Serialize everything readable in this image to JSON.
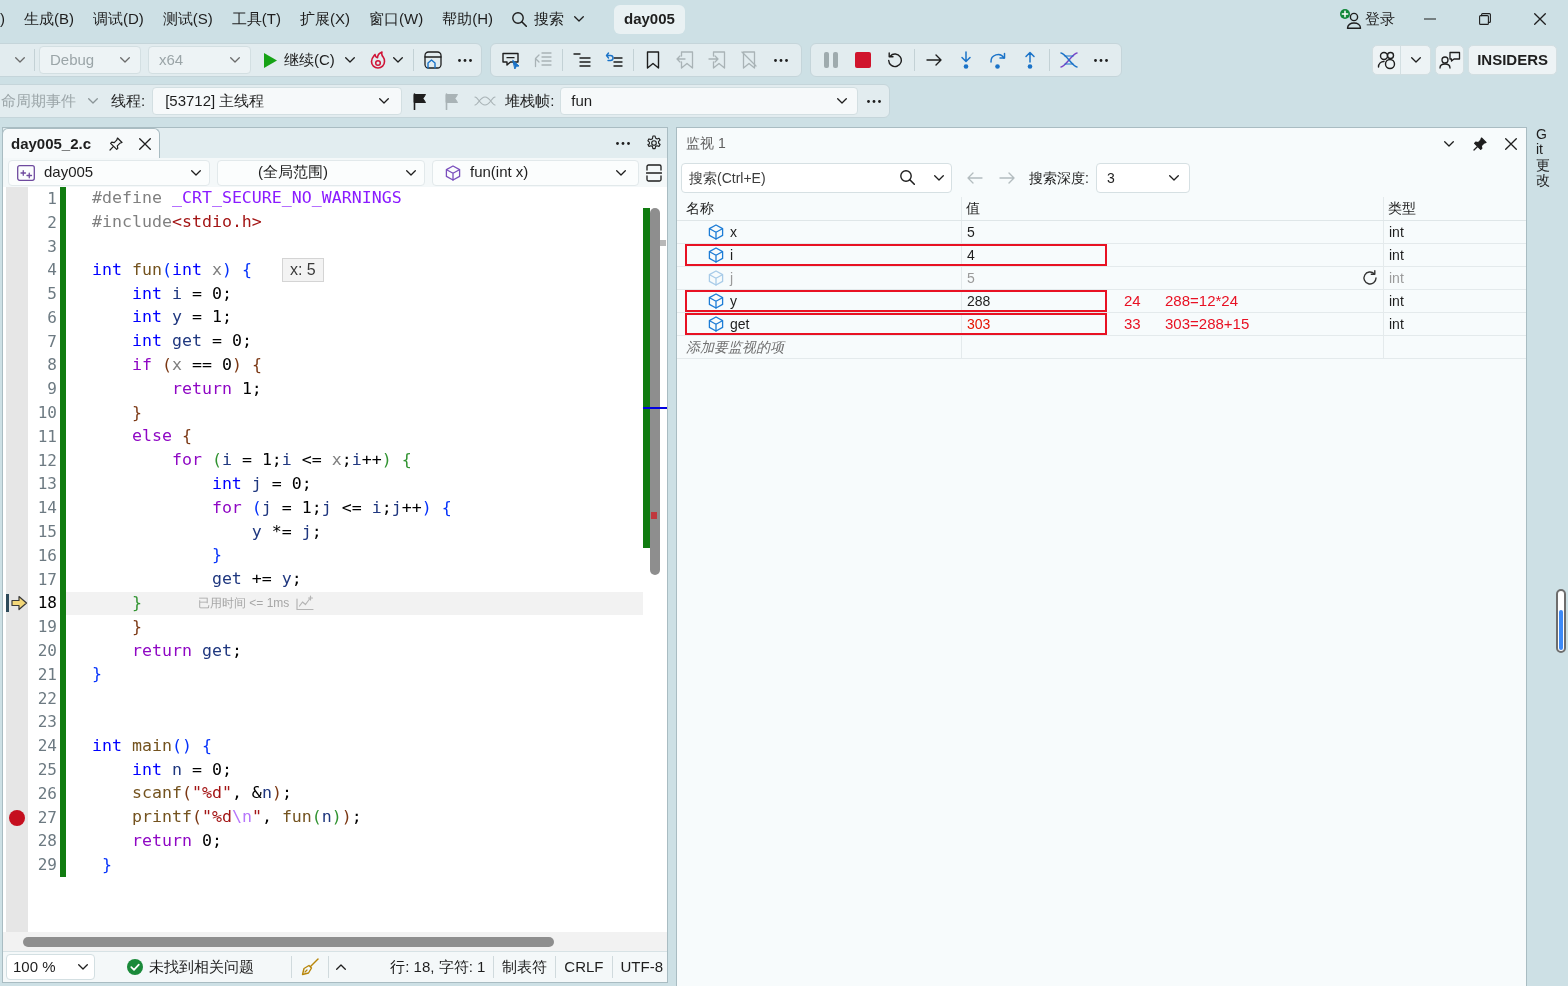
{
  "menu_bar": {
    "items": [
      ")",
      "生成(B)",
      "调试(D)",
      "测试(S)",
      "工具(T)",
      "扩展(X)",
      "窗口(W)",
      "帮助(H)"
    ],
    "search": "搜索",
    "solution": "day005",
    "sign_in": "登录"
  },
  "debug_toolbar": {
    "configuration": {
      "value": "Debug",
      "disabled": true
    },
    "platform": {
      "value": "x64",
      "disabled": true
    },
    "continue": "继续(C)",
    "badge": "INSIDERS"
  },
  "location_toolbar": {
    "lifecycle_events": {
      "value": "命周期事件",
      "disabled": true
    },
    "thread_label": "线程:",
    "thread": "[53712] 主线程",
    "stack_frame_label": "堆栈帧:",
    "stack_frame": "fun"
  },
  "editor": {
    "tab": {
      "title": "day005_2.c",
      "selected": true
    },
    "project": "day005",
    "scope": "(全局范围)",
    "member": "fun(int x)",
    "lines": [
      {
        "number": "1",
        "current": false,
        "breakpoint": false,
        "tokens": [
          {
            "kind": "pp",
            "text": "#define "
          },
          {
            "kind": "mac",
            "text": "_CRT_SECURE_NO_WARNINGS"
          }
        ]
      },
      {
        "number": "2",
        "current": false,
        "breakpoint": false,
        "tokens": [
          {
            "kind": "pp",
            "text": "#include"
          },
          {
            "kind": "inc",
            "text": "<stdio.h>"
          }
        ]
      },
      {
        "number": "3",
        "current": false,
        "breakpoint": false
      },
      {
        "number": "4",
        "current": false,
        "breakpoint": false,
        "tokens": [
          {
            "kind": "kw",
            "text": "int "
          },
          {
            "kind": "fn",
            "text": "fun"
          },
          {
            "kind": "b1",
            "text": "("
          },
          {
            "kind": "kw",
            "text": "int "
          },
          {
            "kind": "par",
            "text": "x"
          },
          {
            "kind": "b1",
            "text": ")"
          },
          {
            "kind": "b1",
            "text": " {"
          }
        ],
        "hint": "x: 5"
      },
      {
        "number": "5",
        "current": false,
        "breakpoint": false,
        "tokens": [
          {
            "kind": "kw",
            "text": "    int "
          },
          {
            "kind": "id",
            "text": "i"
          },
          {
            "kind": "op",
            "text": " = 0;"
          }
        ]
      },
      {
        "number": "6",
        "current": false,
        "breakpoint": false,
        "tokens": [
          {
            "kind": "kw",
            "text": "    int "
          },
          {
            "kind": "id",
            "text": "y"
          },
          {
            "kind": "op",
            "text": " = 1;"
          }
        ]
      },
      {
        "number": "7",
        "current": false,
        "breakpoint": false,
        "tokens": [
          {
            "kind": "kw",
            "text": "    int "
          },
          {
            "kind": "id",
            "text": "get"
          },
          {
            "kind": "op",
            "text": " = 0;"
          }
        ]
      },
      {
        "number": "8",
        "current": false,
        "breakpoint": false,
        "tokens": [
          {
            "kind": "ctl",
            "text": "    if "
          },
          {
            "kind": "b2",
            "text": "("
          },
          {
            "kind": "par",
            "text": "x"
          },
          {
            "kind": "op",
            "text": " == 0"
          },
          {
            "kind": "b2",
            "text": ")"
          },
          {
            "kind": "b2",
            "text": " {"
          }
        ]
      },
      {
        "number": "9",
        "current": false,
        "breakpoint": false,
        "tokens": [
          {
            "kind": "ctl",
            "text": "        return "
          },
          {
            "kind": "op",
            "text": "1;"
          }
        ]
      },
      {
        "number": "10",
        "current": false,
        "breakpoint": false,
        "tokens": [
          {
            "kind": "b2",
            "text": "    }"
          }
        ]
      },
      {
        "number": "11",
        "current": false,
        "breakpoint": false,
        "tokens": [
          {
            "kind": "ctl",
            "text": "    else "
          },
          {
            "kind": "b2",
            "text": "{"
          }
        ]
      },
      {
        "number": "12",
        "current": false,
        "breakpoint": false,
        "tokens": [
          {
            "kind": "ctl",
            "text": "        for "
          },
          {
            "kind": "b3",
            "text": "("
          },
          {
            "kind": "id",
            "text": "i"
          },
          {
            "kind": "op",
            "text": " = 1;"
          },
          {
            "kind": "id",
            "text": "i"
          },
          {
            "kind": "op",
            "text": " <= "
          },
          {
            "kind": "par",
            "text": "x"
          },
          {
            "kind": "op",
            "text": ";"
          },
          {
            "kind": "id",
            "text": "i"
          },
          {
            "kind": "op",
            "text": "++"
          },
          {
            "kind": "b3",
            "text": ")"
          },
          {
            "kind": "b3",
            "text": " {"
          }
        ]
      },
      {
        "number": "13",
        "current": false,
        "breakpoint": false,
        "tokens": [
          {
            "kind": "kw",
            "text": "            int "
          },
          {
            "kind": "id",
            "text": "j"
          },
          {
            "kind": "op",
            "text": " = 0;"
          }
        ]
      },
      {
        "number": "14",
        "current": false,
        "breakpoint": false,
        "tokens": [
          {
            "kind": "ctl",
            "text": "            for "
          },
          {
            "kind": "b1",
            "text": "("
          },
          {
            "kind": "id",
            "text": "j"
          },
          {
            "kind": "op",
            "text": " = 1;"
          },
          {
            "kind": "id",
            "text": "j"
          },
          {
            "kind": "op",
            "text": " <= "
          },
          {
            "kind": "id",
            "text": "i"
          },
          {
            "kind": "op",
            "text": ";"
          },
          {
            "kind": "id",
            "text": "j"
          },
          {
            "kind": "op",
            "text": "++"
          },
          {
            "kind": "b1",
            "text": ")"
          },
          {
            "kind": "b1",
            "text": " {"
          }
        ]
      },
      {
        "number": "15",
        "current": false,
        "breakpoint": false,
        "tokens": [
          {
            "kind": "id",
            "text": "                y"
          },
          {
            "kind": "op",
            "text": " *= "
          },
          {
            "kind": "id",
            "text": "j"
          },
          {
            "kind": "op",
            "text": ";"
          }
        ]
      },
      {
        "number": "16",
        "current": false,
        "breakpoint": false,
        "tokens": [
          {
            "kind": "b1",
            "text": "            }"
          }
        ]
      },
      {
        "number": "17",
        "current": false,
        "breakpoint": false,
        "tokens": [
          {
            "kind": "id",
            "text": "            get"
          },
          {
            "kind": "op",
            "text": " += "
          },
          {
            "kind": "id",
            "text": "y"
          },
          {
            "kind": "op",
            "text": ";"
          }
        ]
      },
      {
        "number": "18",
        "current": true,
        "breakpoint": false,
        "tokens": [
          {
            "kind": "b3",
            "text": "    }"
          }
        ],
        "perf_tip": "已用时间 <= 1ms"
      },
      {
        "number": "19",
        "current": false,
        "breakpoint": false,
        "tokens": [
          {
            "kind": "b2",
            "text": "    }"
          }
        ]
      },
      {
        "number": "20",
        "current": false,
        "breakpoint": false,
        "tokens": [
          {
            "kind": "ctl",
            "text": "    return "
          },
          {
            "kind": "id",
            "text": "get"
          },
          {
            "kind": "op",
            "text": ";"
          }
        ]
      },
      {
        "number": "21",
        "current": false,
        "breakpoint": false,
        "tokens": [
          {
            "kind": "b1",
            "text": "}"
          }
        ]
      },
      {
        "number": "22",
        "current": false,
        "breakpoint": false
      },
      {
        "number": "23",
        "current": false,
        "breakpoint": false
      },
      {
        "number": "24",
        "current": false,
        "breakpoint": false,
        "tokens": [
          {
            "kind": "kw",
            "text": "int "
          },
          {
            "kind": "fn",
            "text": "main"
          },
          {
            "kind": "b1",
            "text": "()"
          },
          {
            "kind": "b1",
            "text": " {"
          }
        ]
      },
      {
        "number": "25",
        "current": false,
        "breakpoint": false,
        "tokens": [
          {
            "kind": "kw",
            "text": "    int "
          },
          {
            "kind": "id",
            "text": "n"
          },
          {
            "kind": "op",
            "text": " = 0;"
          }
        ]
      },
      {
        "number": "26",
        "current": false,
        "breakpoint": false,
        "tokens": [
          {
            "kind": "fn",
            "text": "    scanf"
          },
          {
            "kind": "b2",
            "text": "("
          },
          {
            "kind": "str",
            "text": "\"%d\""
          },
          {
            "kind": "op",
            "text": ", &"
          },
          {
            "kind": "id",
            "text": "n"
          },
          {
            "kind": "b2",
            "text": ")"
          },
          {
            "kind": "op",
            "text": ";"
          }
        ]
      },
      {
        "number": "27",
        "current": false,
        "breakpoint": true,
        "tokens": [
          {
            "kind": "fn",
            "text": "    printf"
          },
          {
            "kind": "b2",
            "text": "("
          },
          {
            "kind": "str",
            "text": "\"%d"
          },
          {
            "kind": "esc",
            "text": "\\n"
          },
          {
            "kind": "str",
            "text": "\""
          },
          {
            "kind": "op",
            "text": ", "
          },
          {
            "kind": "fn",
            "text": "fun"
          },
          {
            "kind": "b3",
            "text": "("
          },
          {
            "kind": "id",
            "text": "n"
          },
          {
            "kind": "b3",
            "text": ")"
          },
          {
            "kind": "b2",
            "text": ")"
          },
          {
            "kind": "op",
            "text": ";"
          }
        ]
      },
      {
        "number": "28",
        "current": false,
        "breakpoint": false,
        "tokens": [
          {
            "kind": "ctl",
            "text": "    return "
          },
          {
            "kind": "op",
            "text": "0;"
          }
        ]
      },
      {
        "number": "29",
        "current": false,
        "breakpoint": false,
        "tokens": [
          {
            "kind": "b1",
            "text": " }"
          }
        ]
      }
    ],
    "status_bar": {
      "zoom": "100 %",
      "issues": "未找到相关问题",
      "position": "行: 18, 字符: 1",
      "indent": "制表符",
      "line_ending": "CRLF",
      "encoding": "UTF-8"
    }
  },
  "watch": {
    "title": "监视 1",
    "search_placeholder": "搜索(Ctrl+E)",
    "depth_label": "搜索深度:",
    "depth": "3",
    "columns": [
      "名称",
      "值",
      "类型"
    ],
    "rows": [
      {
        "name": "x",
        "value": "5",
        "type": "int",
        "stale": false,
        "changed": false,
        "boxed": false
      },
      {
        "name": "i",
        "value": "4",
        "type": "int",
        "stale": false,
        "changed": false,
        "boxed": true
      },
      {
        "name": "j",
        "value": "5",
        "type": "int",
        "stale": true,
        "changed": false,
        "boxed": false
      },
      {
        "name": "y",
        "value": "288",
        "type": "int",
        "stale": false,
        "changed": false,
        "boxed": true,
        "notes": [
          "24",
          "288=12*24"
        ]
      },
      {
        "name": "get",
        "value": "303",
        "type": "int",
        "stale": false,
        "changed": true,
        "boxed": true,
        "notes": [
          "33",
          "303=288+15"
        ]
      }
    ],
    "add_placeholder": "添加要监视的项"
  },
  "side_tab": "Git 更改"
}
